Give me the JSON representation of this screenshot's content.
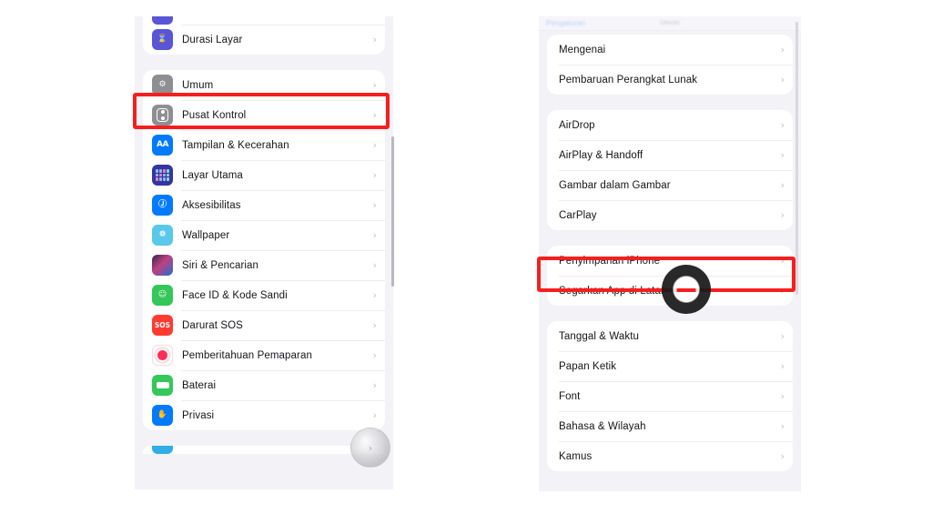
{
  "meta": {
    "app": "iOS Settings",
    "language": "Indonesian",
    "background_color": "#ffffff",
    "screen_background": "#f2f2f7",
    "card_background": "#ffffff",
    "accent_highlight": "#f71e1e"
  },
  "left_screen": {
    "name": "settings-root-list",
    "scrollbar": {
      "visible": true
    },
    "groups": [
      {
        "partial": "top",
        "rows": [
          {
            "label": "",
            "icon": "purple-app-icon",
            "icon_class": "g-purple",
            "glyph": "",
            "partial": true
          },
          {
            "label": "Durasi Layar",
            "icon": "hourglass-icon",
            "icon_class": "g-hourglass",
            "glyph": "⌛"
          }
        ]
      },
      {
        "highlighted": true,
        "rows": [
          {
            "label": "Umum",
            "icon": "gear-icon",
            "icon_class": "g-gear",
            "glyph": "⚙"
          },
          {
            "label": "Pusat Kontrol",
            "icon": "control-center-icon",
            "icon_class": "g-control",
            "glyph": "control-pill"
          },
          {
            "label": "Tampilan & Kecerahan",
            "icon": "display-brightness-icon",
            "icon_class": "g-aa",
            "glyph": "AA"
          },
          {
            "label": "Layar Utama",
            "icon": "home-screen-icon",
            "icon_class": "g-home",
            "glyph": "dot-grid"
          },
          {
            "label": "Aksesibilitas",
            "icon": "accessibility-icon",
            "icon_class": "g-access",
            "glyph": "Ⓙ"
          },
          {
            "label": "Wallpaper",
            "icon": "wallpaper-icon",
            "icon_class": "g-wallpaper",
            "glyph": "❁"
          },
          {
            "label": "Siri & Pencarian",
            "icon": "siri-icon",
            "icon_class": "g-siri",
            "glyph": ""
          },
          {
            "label": "Face ID & Kode Sandi",
            "icon": "face-id-icon",
            "icon_class": "g-faceid",
            "glyph": "☺"
          },
          {
            "label": "Darurat SOS",
            "icon": "sos-icon",
            "icon_class": "g-sos",
            "glyph": "SOS"
          },
          {
            "label": "Pemberitahuan Pemaparan",
            "icon": "exposure-notification-icon",
            "icon_class": "g-exposure",
            "glyph": "expo-burst"
          },
          {
            "label": "Baterai",
            "icon": "battery-icon",
            "icon_class": "g-battery",
            "glyph": "battery-body"
          },
          {
            "label": "Privasi",
            "icon": "privacy-hand-icon",
            "icon_class": "g-privacy",
            "glyph": "✋"
          }
        ]
      },
      {
        "partial": "bottom",
        "rows": [
          {
            "label": "",
            "icon": "blue-app-icon",
            "icon_class": "g-blue",
            "glyph": "",
            "partial": true
          }
        ]
      }
    ]
  },
  "right_screen": {
    "name": "settings-general-list",
    "nav": {
      "back_label": "Pengaturan",
      "title": "Umum"
    },
    "groups": [
      {
        "rows": [
          {
            "label": "Mengenai"
          },
          {
            "label": "Pembaruan Perangkat Lunak"
          }
        ]
      },
      {
        "rows": [
          {
            "label": "AirDrop"
          },
          {
            "label": "AirPlay & Handoff"
          },
          {
            "label": "Gambar dalam Gambar"
          },
          {
            "label": "CarPlay"
          }
        ]
      },
      {
        "highlighted": true,
        "rows": [
          {
            "label": "Penyimpanan iPhone"
          },
          {
            "label": "Segarkan App di Latar"
          }
        ]
      },
      {
        "rows": [
          {
            "label": "Tanggal & Waktu"
          },
          {
            "label": "Papan Ketik"
          },
          {
            "label": "Font"
          },
          {
            "label": "Bahasa & Wilayah"
          },
          {
            "label": "Kamus"
          }
        ]
      }
    ]
  },
  "annotations": {
    "chevron": "›",
    "redbox_left_target": "Umum",
    "redbox_right_target": "Penyimpanan iPhone",
    "tap_indicator_target": "Penyimpanan iPhone",
    "cursor_target": "Privasi"
  }
}
